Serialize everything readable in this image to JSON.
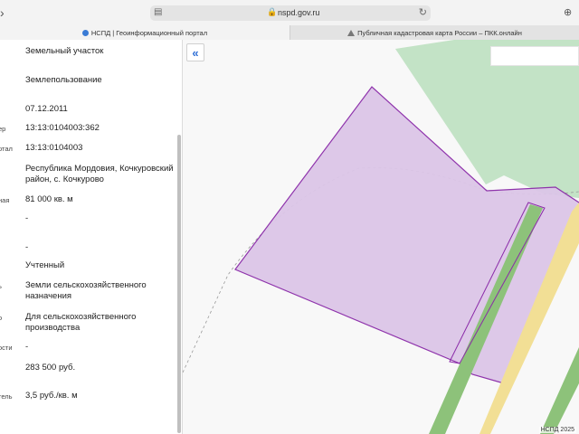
{
  "browser": {
    "url": "nspd.gov.ru",
    "tabs": [
      {
        "label": "НСПД | Геоинформационный портал"
      },
      {
        "label": "Публичная кадастровая карта России – ПКК.онлайн"
      }
    ]
  },
  "panel": {
    "rows": [
      {
        "label": "",
        "value": "Земельный участок"
      },
      {
        "label": "",
        "value": "Землепользование"
      },
      {
        "label": "",
        "value": "07.12.2011"
      },
      {
        "label": "ер",
        "value": "13:13:0104003:362"
      },
      {
        "label": "ртал",
        "value": "13:13:0104003"
      },
      {
        "label": "",
        "value": "Республика Мордовия, Кочкуровский район, с. Кочкурово"
      },
      {
        "label": "ная",
        "value": "81 000 кв. м"
      },
      {
        "label": "",
        "value": "-"
      },
      {
        "label": "",
        "value": "-"
      },
      {
        "label": "",
        "value": "Учтенный"
      },
      {
        "label": "ь",
        "value": "Земли сельскохозяйственного назначения"
      },
      {
        "label": "о",
        "value": "Для сельскохозяйственного производства"
      },
      {
        "label": "ости",
        "value": "-"
      },
      {
        "label": "",
        "value": "283 500 руб."
      },
      {
        "label": "тель",
        "value": "3,5 руб./кв. м"
      }
    ]
  },
  "map": {
    "attribution": "НСПД 2025",
    "collapse_icon": "double-chevron-left-icon",
    "colors": {
      "parcel_fill": "#dcc6e8",
      "parcel_stroke": "#8a2aa8",
      "green_zone": "#bde0c0",
      "road_green": "#8dc27a",
      "road_yellow": "#f2df95"
    }
  }
}
